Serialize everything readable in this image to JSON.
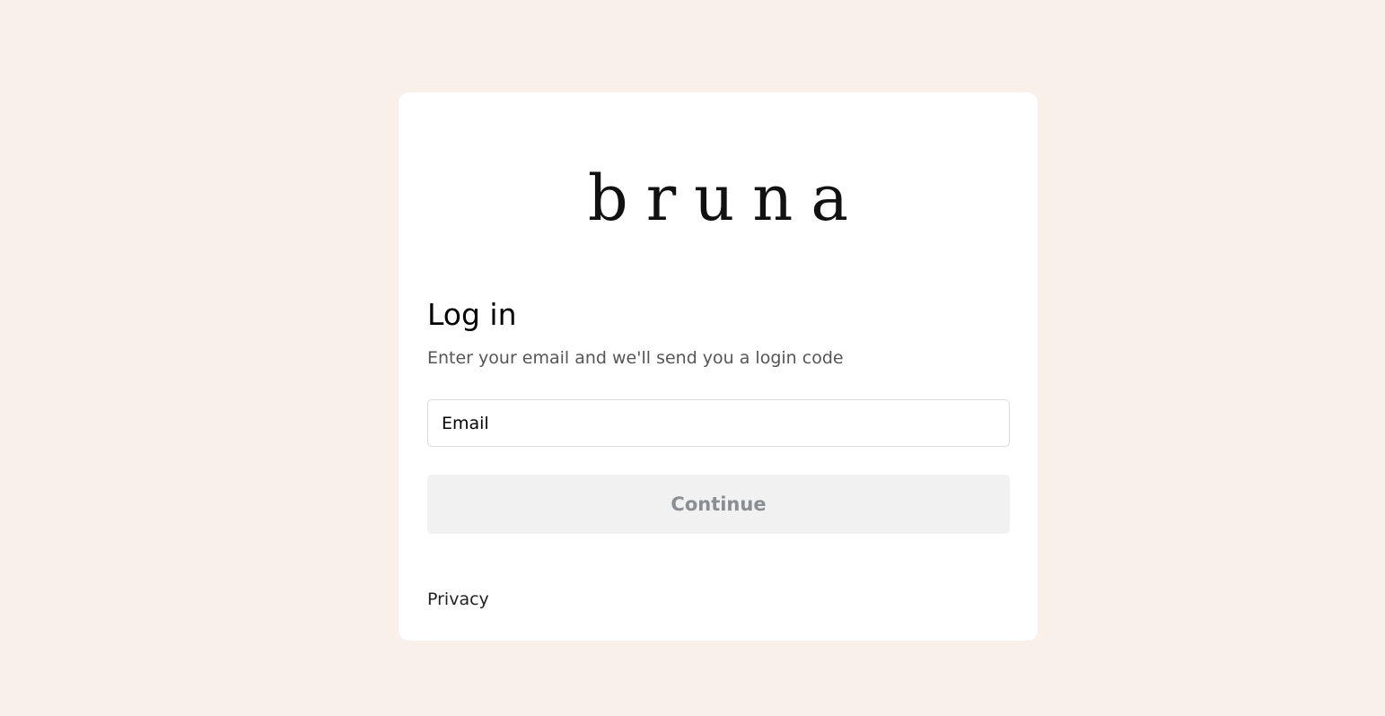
{
  "brand": {
    "logo_text": "bruna"
  },
  "login": {
    "title": "Log in",
    "subtitle": "Enter your email and we'll send you a login code",
    "email_placeholder": "Email",
    "email_value": "",
    "continue_label": "Continue",
    "privacy_label": "Privacy"
  },
  "colors": {
    "page_background": "#f9f0ea",
    "card_background": "#ffffff",
    "button_background": "#f1f1f1",
    "button_text": "#8a8d91"
  }
}
